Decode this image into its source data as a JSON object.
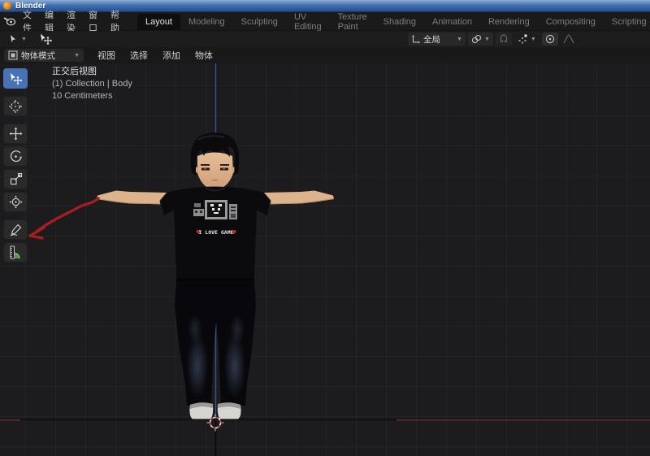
{
  "window": {
    "title": "Blender"
  },
  "menu_bar": {
    "menus": [
      "文件",
      "编辑",
      "渲染",
      "窗口",
      "帮助"
    ],
    "workspaces": [
      {
        "label": "Layout",
        "active": true
      },
      {
        "label": "Modeling",
        "active": false
      },
      {
        "label": "Sculpting",
        "active": false
      },
      {
        "label": "UV Editing",
        "active": false
      },
      {
        "label": "Texture Paint",
        "active": false
      },
      {
        "label": "Shading",
        "active": false
      },
      {
        "label": "Animation",
        "active": false
      },
      {
        "label": "Rendering",
        "active": false
      },
      {
        "label": "Compositing",
        "active": false
      },
      {
        "label": "Scripting",
        "active": false
      }
    ],
    "add_workspace_label": "+"
  },
  "tool_settings": {
    "orientation_label": "全局"
  },
  "viewport_header": {
    "mode_label": "物体模式",
    "menus": [
      "视图",
      "选择",
      "添加",
      "物体"
    ]
  },
  "viewport": {
    "overlay": {
      "view_label": "正交后视图",
      "context_label": "(1) Collection | Body",
      "scale_label": "10 Centimeters"
    },
    "model": {
      "shirt_text": "I LOVE GAME"
    }
  },
  "toolbar": {
    "tools": [
      "tweak-select",
      "cursor",
      "move",
      "rotate",
      "scale",
      "transform",
      "annotate",
      "measure"
    ],
    "active_tool": "tweak-select"
  },
  "icons": {
    "heart": "♥",
    "chevron_down": "▾"
  },
  "colors": {
    "active_tool_blue": "#4772b3",
    "axis_z_blue": "#3d5a9e",
    "axis_x_red": "#5a2a2d",
    "annotation_red": "#a51e1e",
    "title_bar_blue": "#3a6ea5",
    "skin": "#dcb38c",
    "measure_green": "#5d8f55"
  }
}
